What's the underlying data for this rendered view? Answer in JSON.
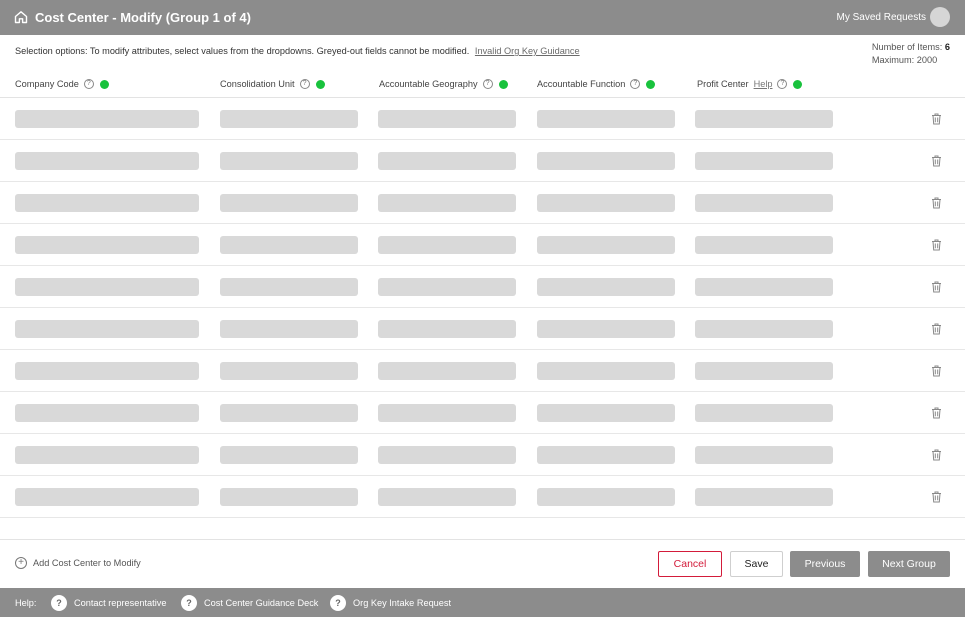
{
  "header": {
    "title": "Cost Center - Modify (Group 1 of 4)",
    "saved_requests": "My Saved Requests"
  },
  "instructions": {
    "text": "Selection options: To modify attributes, select values from the dropdowns. Greyed-out fields cannot be modified.",
    "link": "Invalid Org Key Guidance"
  },
  "items_info": {
    "count_label": "Number of Items:",
    "count_value": "6",
    "max_label": "Maximum:",
    "max_value": "2000"
  },
  "columns": [
    {
      "label": "Company Code",
      "status_color": "#19c23d"
    },
    {
      "label": "Consolidation Unit",
      "status_color": "#19c23d"
    },
    {
      "label": "Accountable Geography",
      "status_color": "#19c23d"
    },
    {
      "label": "Accountable Function",
      "status_color": "#19c23d"
    },
    {
      "label": "Profit Center",
      "help_link": "Help",
      "status_color": "#19c23d"
    }
  ],
  "help_symbol": "?",
  "row_icon": "trash-icon",
  "footer": {
    "add_label": "Add Cost Center to Modify",
    "cancel": "Cancel",
    "save": "Save",
    "previous": "Previous",
    "next": "Next Group"
  },
  "help_bar": {
    "label": "Help:",
    "items": [
      "Contact representative",
      "Cost Center Guidance Deck",
      "Org Key Intake Request"
    ]
  },
  "colors": {
    "header_bg": "#8c8c8c",
    "accent_red": "#d31b3a",
    "status_green": "#19c23d",
    "field_disabled": "#d9d9d9"
  }
}
